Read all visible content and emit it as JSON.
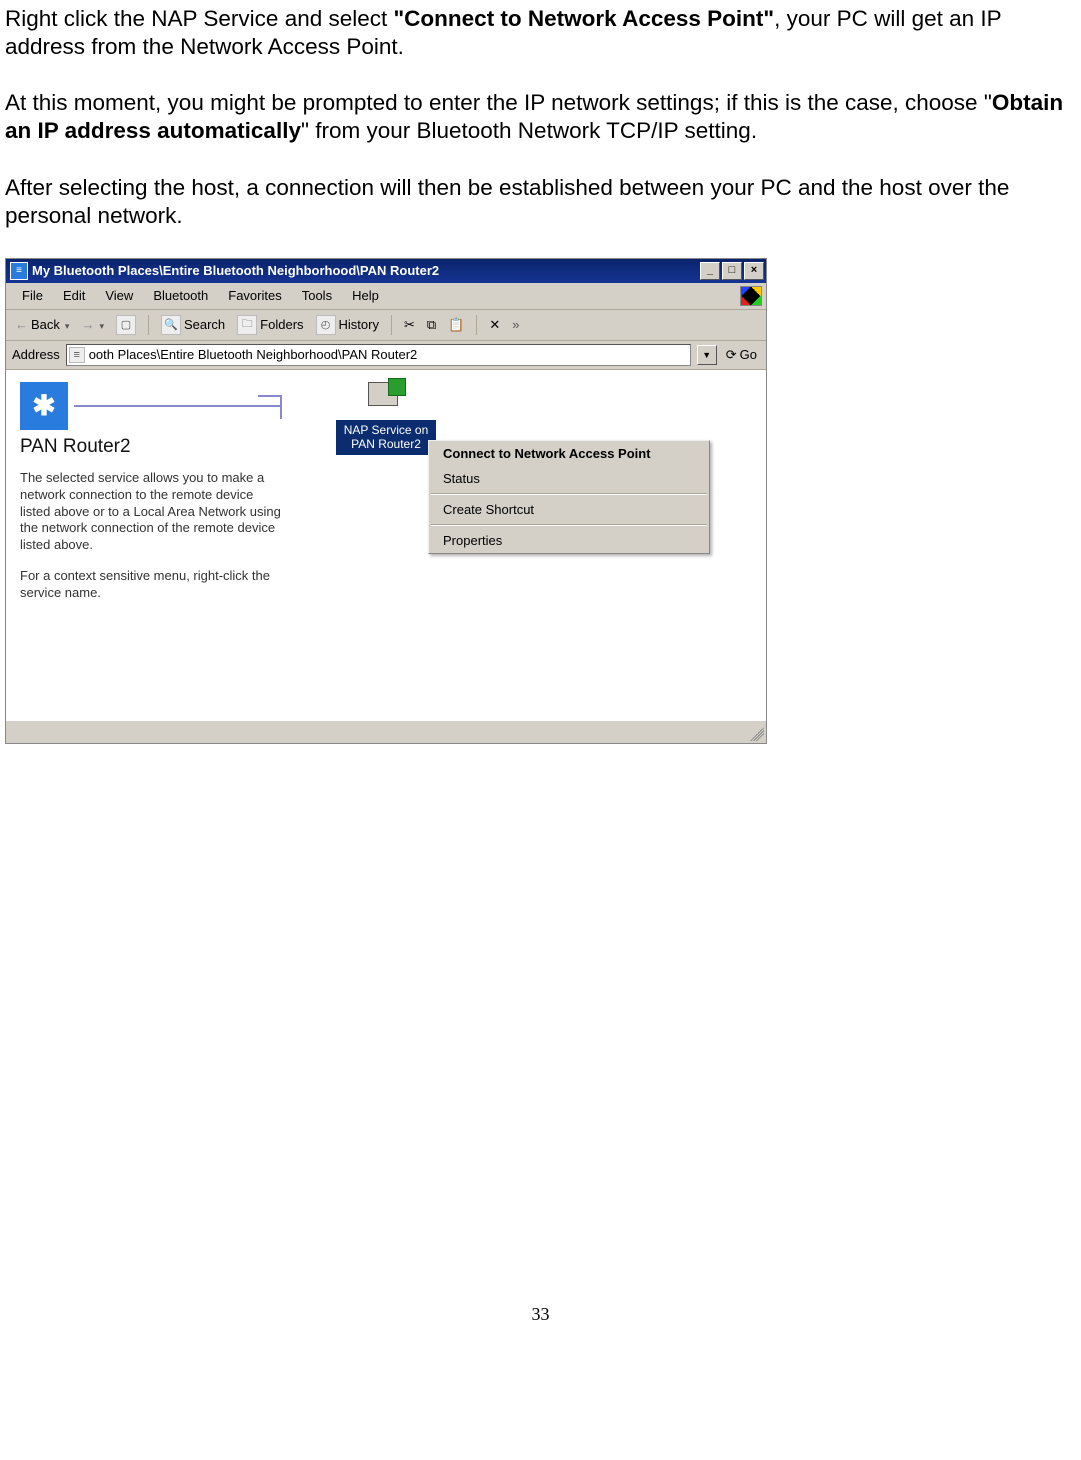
{
  "doc": {
    "para1_pre": "Right click the NAP Service and select ",
    "para1_bold": "\"Connect to Network Access Point\"",
    "para1_post": ", your PC will get an IP address from the Network Access Point.",
    "para2_pre": "At this moment, you might be prompted to enter the IP network settings; if this is the case, choose \"",
    "para2_bold": "Obtain an IP address automatically",
    "para2_post": "\" from your Bluetooth Network TCP/IP setting.",
    "para3": "After selecting the host, a connection will then be established between your PC and the host over the personal network.",
    "page_number": "33"
  },
  "window": {
    "title": "My Bluetooth Places\\Entire Bluetooth Neighborhood\\PAN Router2",
    "min_label": "_",
    "max_label": "□",
    "close_label": "×"
  },
  "menu": {
    "file": "File",
    "edit": "Edit",
    "view": "View",
    "bluetooth": "Bluetooth",
    "favorites": "Favorites",
    "tools": "Tools",
    "help": "Help"
  },
  "toolbar": {
    "back": "Back",
    "search": "Search",
    "folders": "Folders",
    "history": "History",
    "cut_glyph": "✂",
    "copy_glyph": "⧉",
    "paste_glyph": "📋",
    "delete_glyph": "✕"
  },
  "address": {
    "label": "Address",
    "value": "ooth Places\\Entire Bluetooth Neighborhood\\PAN Router2",
    "go": "Go"
  },
  "sidebar": {
    "title": "PAN Router2",
    "bt_glyph": "✱",
    "p1": "The selected service allows you to make a network connection to the remote device listed above or to a Local Area Network using the network connection of the remote device listed above.",
    "p2": "For a context sensitive menu, right-click the service name."
  },
  "service": {
    "label": "NAP Service on PAN Router2"
  },
  "context_menu": {
    "item1": "Connect to Network Access Point",
    "item2": "Status",
    "item3": "Create Shortcut",
    "item4": "Properties"
  }
}
